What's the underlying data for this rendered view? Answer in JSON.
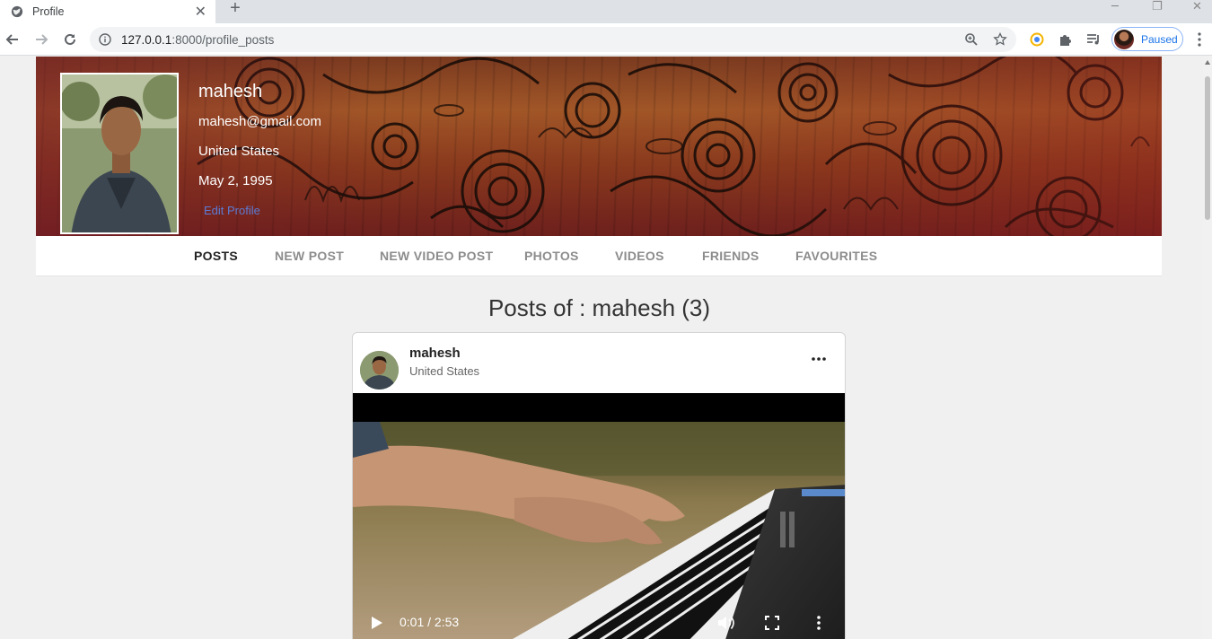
{
  "browser": {
    "tab_title": "Profile",
    "url_host": "127.0.0.1",
    "url_port_path": ":8000/profile_posts",
    "profile_status": "Paused"
  },
  "profile": {
    "name": "mahesh",
    "email": "mahesh@gmail.com",
    "country": "United States",
    "birthdate": "May 2, 1995",
    "edit_label": "Edit Profile"
  },
  "nav": {
    "items": [
      {
        "label": "POSTS",
        "active": true
      },
      {
        "label": "NEW POST",
        "active": false
      },
      {
        "label": "NEW VIDEO POST",
        "active": false
      },
      {
        "label": "PHOTOS",
        "active": false
      },
      {
        "label": "VIDEOS",
        "active": false
      },
      {
        "label": "FRIENDS",
        "active": false
      },
      {
        "label": "FAVOURITES",
        "active": false
      }
    ]
  },
  "posts": {
    "heading": "Posts of : mahesh (3)",
    "items": [
      {
        "author": "mahesh",
        "location": "United States",
        "video": {
          "current_time": "0:01",
          "duration": "2:53",
          "time_label": "0:01 / 2:53"
        }
      }
    ]
  },
  "colors": {
    "accent_link": "#5b7bd5",
    "chrome_accent": "#1a73e8"
  }
}
